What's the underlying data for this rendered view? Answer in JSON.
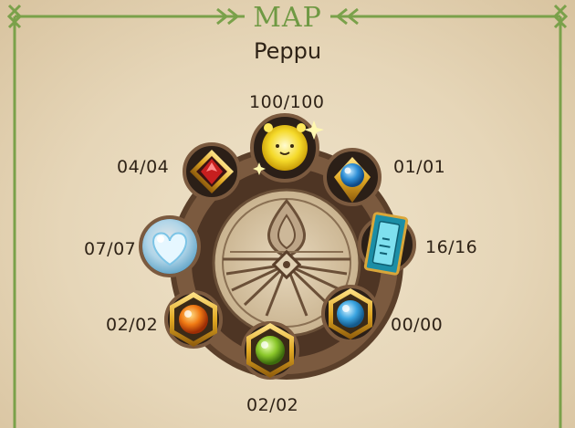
{
  "header": {
    "title": "MAP",
    "region_name": "Peppu"
  },
  "collection": {
    "wheel_center_icon": "leaf-emblem-icon",
    "slots": [
      {
        "key": "spirit",
        "icon": "glowing-spirit-icon",
        "count": "100/100",
        "color": "#f3d21b"
      },
      {
        "key": "blue-charm",
        "icon": "blue-orb-icon",
        "count": "01/01",
        "color": "#2f8fd6"
      },
      {
        "key": "card",
        "icon": "card-icon",
        "count": "16/16",
        "color": "#39b3c9"
      },
      {
        "key": "blue-gem",
        "icon": "blue-gem-icon",
        "count": "00/00",
        "color": "#3aa4e0"
      },
      {
        "key": "green-gem",
        "icon": "green-gem-icon",
        "count": "02/02",
        "color": "#8ac72a"
      },
      {
        "key": "orange-gem",
        "icon": "orange-gem-icon",
        "count": "02/02",
        "color": "#f07a14"
      },
      {
        "key": "crystal-heart",
        "icon": "crystal-heart-icon",
        "count": "07/07",
        "color": "#bfe9ff"
      },
      {
        "key": "red-gem",
        "icon": "red-gem-icon",
        "count": "04/04",
        "color": "#c71f1f"
      }
    ]
  }
}
